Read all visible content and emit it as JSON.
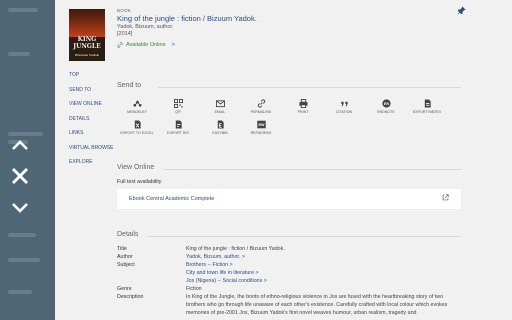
{
  "record": {
    "type": "BOOK",
    "title": "King of the jungle : fiction / Bizuum Yadok.",
    "author_line": "Yadok, Bizuum, author.",
    "date": "[2014]",
    "availability": "Available Online",
    "availability_arrow": ">",
    "cover_text_1": "KING",
    "cover_text_2": "JUNGLE",
    "cover_text_3": "Bizuum Yadok"
  },
  "side_nav": [
    "TOP",
    "SEND TO",
    "VIEW ONLINE",
    "DETAILS",
    "LINKS",
    "VIRTUAL BROWSE",
    "EXPLORE"
  ],
  "send_to": {
    "heading": "Send to",
    "tools": [
      {
        "label": "MENDELEY",
        "icon": "mendeley-icon"
      },
      {
        "label": "QR",
        "icon": "qr-code-icon"
      },
      {
        "label": "EMAIL",
        "icon": "email-icon"
      },
      {
        "label": "PERMALINK",
        "icon": "link-icon"
      },
      {
        "label": "PRINT",
        "icon": "print-icon"
      },
      {
        "label": "CITATION",
        "icon": "quote-icon"
      },
      {
        "label": "ENDNOTE",
        "icon": "endnote-icon",
        "glyph": "EN"
      },
      {
        "label": "EXPORT BIBTEX",
        "icon": "bibtex-icon"
      },
      {
        "label": "EXPORT TO EXCEL",
        "icon": "excel-icon"
      },
      {
        "label": "EXPORT RIS",
        "icon": "ris-icon"
      },
      {
        "label": "EASYBIB",
        "icon": "easybib-icon"
      },
      {
        "label": "REFWORKS",
        "icon": "refworks-icon",
        "glyph": "RW"
      }
    ]
  },
  "view_online": {
    "heading": "View Online",
    "full_text_label": "Full text availability",
    "provider": "Ebook Central Academic Complete"
  },
  "details": {
    "heading": "Details",
    "rows": [
      {
        "key": "Title",
        "values": [
          "King of the jungle : fiction / Bizuum Yadok."
        ]
      },
      {
        "key": "Author",
        "values": [
          "Yadok, Bizuum, author. >"
        ],
        "link": true
      },
      {
        "key": "Subject",
        "values": [
          "Brothers -- Fiction >",
          "City and town life in literature >",
          "Jos (Nigeria) -- Social conditions >"
        ],
        "link": true
      },
      {
        "key": "Genre",
        "values": [
          "Fiction"
        ]
      },
      {
        "key": "Description",
        "values": [
          "In King of the Jungle, the boots of ethno-religious violence in Jos are fused with the heartbreaking story of two brothers who go through life unaware of each other's existence. Carefully crafted with local colour which evokes memories of pre-2001 Jos, Bizuum Yadok's first novel weaves humour, urban realism, tragedy and"
        ]
      }
    ]
  },
  "colors": {
    "accent": "#2c4d8a",
    "panel": "#f1f1f1",
    "overlay": "#4f6677",
    "available": "#3a8a3a"
  }
}
